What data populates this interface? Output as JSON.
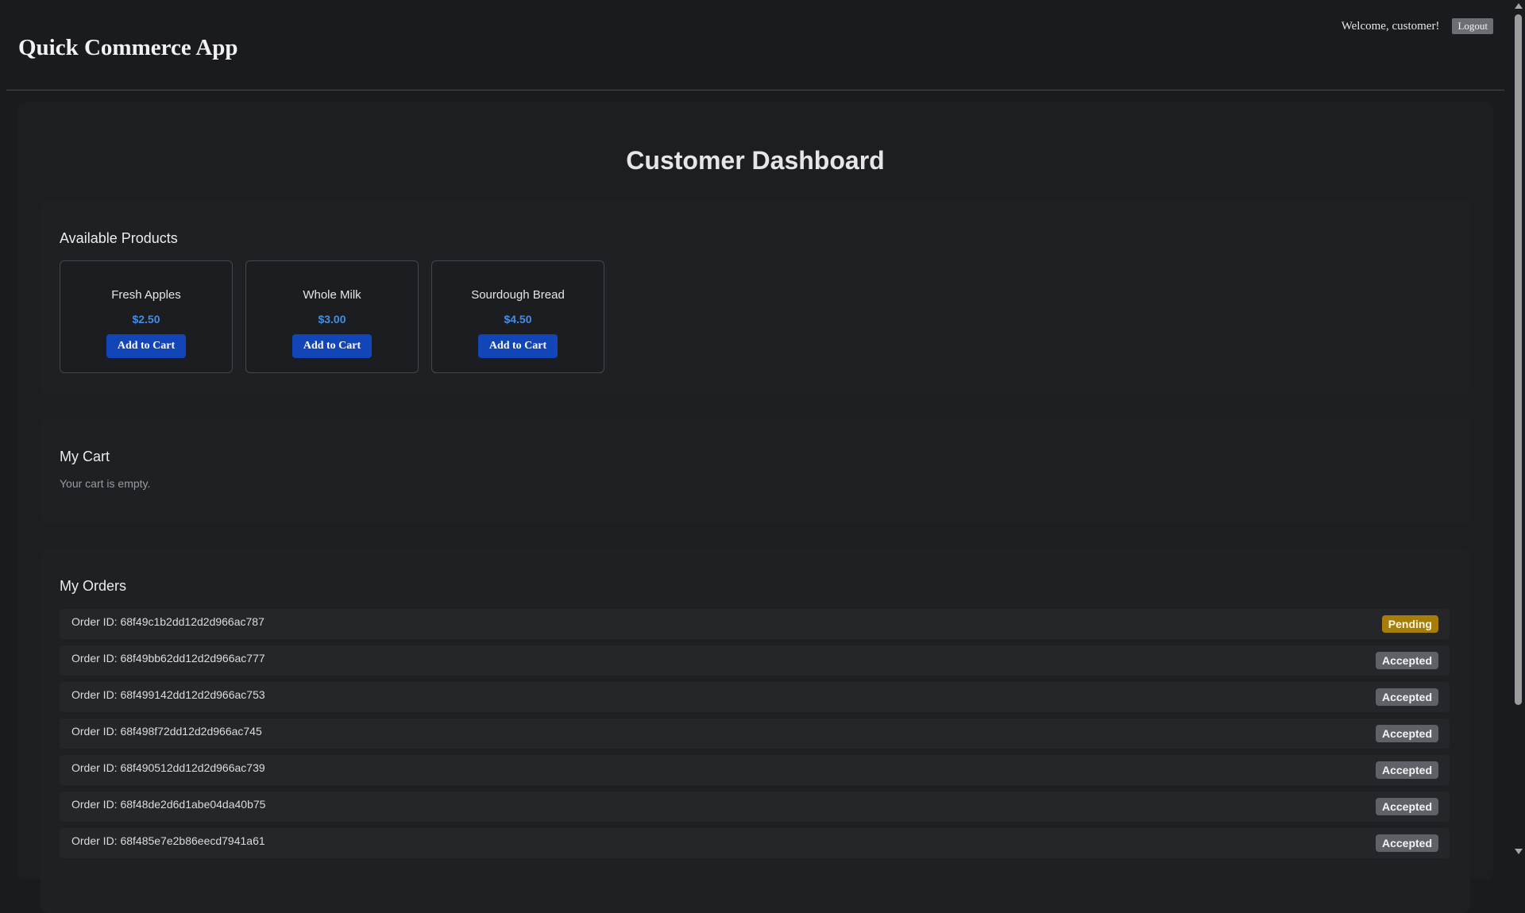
{
  "header": {
    "app_title": "Quick Commerce App",
    "welcome_text": "Welcome, customer!",
    "logout_label": "Logout"
  },
  "dashboard": {
    "title": "Customer Dashboard"
  },
  "products": {
    "heading": "Available Products",
    "items": [
      {
        "name": "Fresh Apples",
        "price": "$2.50",
        "button_label": "Add to Cart"
      },
      {
        "name": "Whole Milk",
        "price": "$3.00",
        "button_label": "Add to Cart"
      },
      {
        "name": "Sourdough Bread",
        "price": "$4.50",
        "button_label": "Add to Cart"
      }
    ]
  },
  "cart": {
    "heading": "My Cart",
    "empty_text": "Your cart is empty."
  },
  "orders": {
    "heading": "My Orders",
    "items": [
      {
        "id_text": "Order ID: 68f49c1b2dd12d2d966ac787",
        "status": "Pending"
      },
      {
        "id_text": "Order ID: 68f49bb62dd12d2d966ac777",
        "status": "Accepted"
      },
      {
        "id_text": "Order ID: 68f499142dd12d2d966ac753",
        "status": "Accepted"
      },
      {
        "id_text": "Order ID: 68f498f72dd12d2d966ac745",
        "status": "Accepted"
      },
      {
        "id_text": "Order ID: 68f490512dd12d2d966ac739",
        "status": "Accepted"
      },
      {
        "id_text": "Order ID: 68f48de2d6d1abe04da40b75",
        "status": "Accepted"
      },
      {
        "id_text": "Order ID: 68f485e7e2b86eecd7941a61",
        "status": "Accepted"
      }
    ]
  },
  "colors": {
    "background": "#1a1b1e",
    "price_accent": "#3f8fe8",
    "primary_button": "#1246b8",
    "pending_badge": "#a67c0a",
    "accepted_badge": "#5f6166"
  }
}
